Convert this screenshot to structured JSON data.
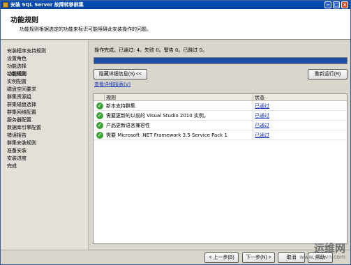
{
  "window": {
    "title": "安装 SQL Server 故障转移群集"
  },
  "header": {
    "title": "功能规则",
    "description": "功能规则根据选定的功能来标识可能阻碍此安装操作的问题。"
  },
  "sidebar": {
    "items": [
      {
        "label": "安装程序支持规则"
      },
      {
        "label": "设置角色"
      },
      {
        "label": "功能选择"
      },
      {
        "label": "功能规则",
        "active": true
      },
      {
        "label": "实例配置"
      },
      {
        "label": "磁盘空间要求"
      },
      {
        "label": "群集资源组"
      },
      {
        "label": "群集磁盘选择"
      },
      {
        "label": "群集网络配置"
      },
      {
        "label": "服务器配置"
      },
      {
        "label": "数据库引擎配置"
      },
      {
        "label": "错误报告"
      },
      {
        "label": "群集安装规则"
      },
      {
        "label": "准备安装"
      },
      {
        "label": "安装进度"
      },
      {
        "label": "完成"
      }
    ]
  },
  "main": {
    "status_text": "操作完成。已通过: 4。失败 0。警告 0。已跳过 0。",
    "hide_details_button": "隐藏详细信息(S) <<",
    "rerun_button": "重新运行(R)",
    "report_link": "查看详细报表(V)",
    "progress": 1.0,
    "table": {
      "headers": {
        "rule": "规则",
        "status": "状态"
      },
      "rows": [
        {
          "rule": "新本支持群集",
          "status": "已通过"
        },
        {
          "rule": "需要更新的以前的 Visual Studio 2010 实例。",
          "status": "已通过"
        },
        {
          "rule": "产品更新语言兼容性",
          "status": "已通过"
        },
        {
          "rule": "需要 Microsoft .NET Framework 3.5 Service Pack 1",
          "status": "已通过"
        }
      ]
    }
  },
  "footer": {
    "back_button": "< 上一步(B)",
    "next_button": "下一步(N) >",
    "cancel_button": "取消",
    "help_button": "帮助",
    "watermark_title": "运维网",
    "watermark_url": "www.yunvn.com"
  },
  "colors": {
    "titlebar": "#0048ad",
    "progress": "#1d4da4",
    "link": "#1733b2",
    "check": "#3ba236"
  },
  "icons": {
    "check": "check-circle-icon",
    "app": "sql-server-installer-icon"
  }
}
